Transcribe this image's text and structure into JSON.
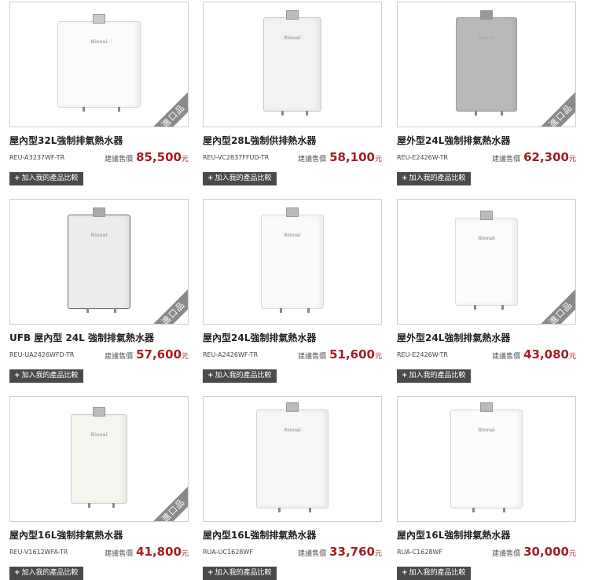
{
  "ui": {
    "price_label": "建議售價",
    "currency_unit": "元",
    "add_compare": "加入我的產品比較",
    "import_badge": "進口品",
    "brand_mark": "Rinnai"
  },
  "products": [
    {
      "name": "屋內型32L強制排氣熱水器",
      "model": "REU-A3237WF-TR",
      "price": "85,500",
      "badge": true
    },
    {
      "name": "屋內型28L強制供排熱水器",
      "model": "REU-VC2837FFUD-TR",
      "price": "58,100",
      "badge": false
    },
    {
      "name": "屋外型24L強制排氣熱水器",
      "model": "REU-E2426W-TR",
      "price": "62,300",
      "badge": true
    },
    {
      "name": "UFB 屋內型 24L 強制排氣熱水器",
      "model": "REU-UA2426WFD-TR",
      "price": "57,600",
      "badge": true
    },
    {
      "name": "屋內型24L強制排氣熱水器",
      "model": "REU-A2426WF-TR",
      "price": "51,600",
      "badge": false
    },
    {
      "name": "屋外型24L強制排氣熱水器",
      "model": "REU-E2426W-TR",
      "price": "43,080",
      "badge": true
    },
    {
      "name": "屋內型16L強制排氣熱水器",
      "model": "REU-V1612WFA-TR",
      "price": "41,800",
      "badge": true
    },
    {
      "name": "屋內型16L強制排氣熱水器",
      "model": "RUA-UC1628WF",
      "price": "33,760",
      "badge": false
    },
    {
      "name": "屋內型16L強制排氣熱水器",
      "model": "RUA-C1628WF",
      "price": "30,000",
      "badge": false
    }
  ]
}
